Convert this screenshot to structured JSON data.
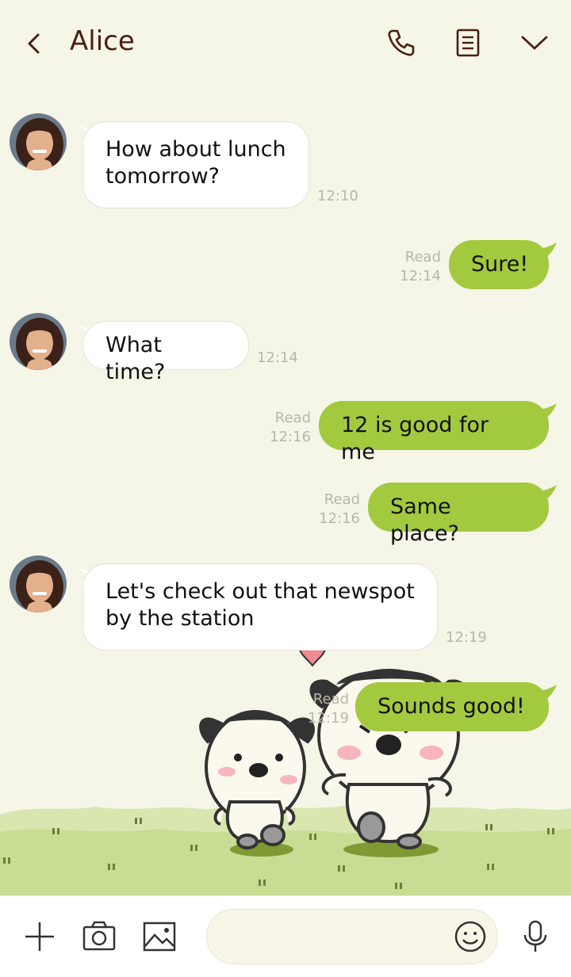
{
  "header": {
    "title": "Alice",
    "icons": [
      "back-icon",
      "phone-icon",
      "notes-icon",
      "chevron-down-icon"
    ]
  },
  "messages": [
    {
      "side": "in",
      "text_lines": [
        "How about lunch",
        "tomorrow?"
      ],
      "time": "12:10"
    },
    {
      "side": "out",
      "text": "Sure!",
      "read": "Read",
      "time": "12:14"
    },
    {
      "side": "in",
      "text": "What time?",
      "time": "12:14"
    },
    {
      "side": "out",
      "text": "12 is good for me",
      "read": "Read",
      "time": "12:16"
    },
    {
      "side": "out",
      "text": "Same place?",
      "read": "Read",
      "time": "12:16"
    },
    {
      "side": "in",
      "text_lines": [
        "Let's check out that newspot",
        "by the station"
      ],
      "time": "12:19"
    },
    {
      "side": "out",
      "text": "Sounds good!",
      "read": "Read",
      "time": "12:19"
    }
  ],
  "footer": {
    "input_value": "",
    "icons": [
      "plus-icon",
      "camera-icon",
      "image-icon",
      "emoji-icon",
      "microphone-icon"
    ]
  },
  "colors": {
    "background": "#f5f5e8",
    "outgoing_bubble": "#a3c93f",
    "incoming_bubble": "#ffffff",
    "title": "#4a1f14",
    "timestamp": "#b8b8a8"
  }
}
